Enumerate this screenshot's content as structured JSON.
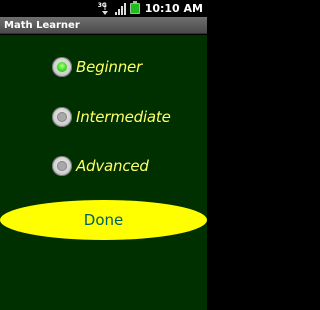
{
  "status_bar": {
    "network_label": "3G",
    "time": "10:10 AM",
    "icons": [
      "network-3g-icon",
      "signal-icon",
      "battery-icon"
    ]
  },
  "app": {
    "title": "Math Learner"
  },
  "levels": {
    "selected": "Beginner",
    "options": [
      {
        "label": "Beginner",
        "checked": true
      },
      {
        "label": "Intermediate",
        "checked": false
      },
      {
        "label": "Advanced",
        "checked": false
      }
    ]
  },
  "actions": {
    "done_label": "Done"
  },
  "colors": {
    "background": "#003000",
    "option_text": "#ffff66",
    "button_fill": "#ffff00",
    "button_text": "#006060",
    "radio_checked": "#43d92c"
  }
}
